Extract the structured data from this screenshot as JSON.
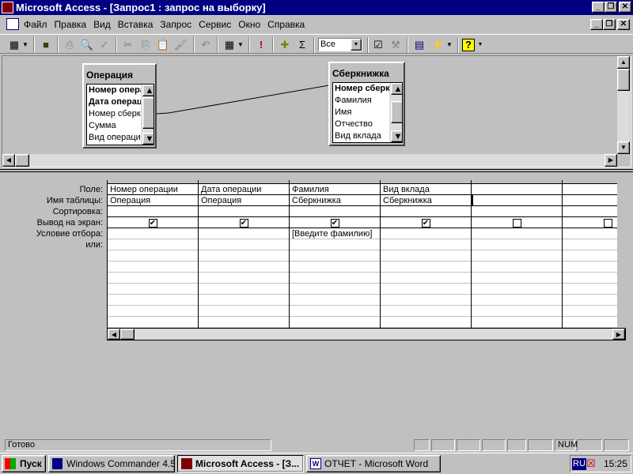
{
  "window": {
    "title": "Microsoft Access - [Запрос1 : запрос на выборку]"
  },
  "menu": [
    "Файл",
    "Правка",
    "Вид",
    "Вставка",
    "Запрос",
    "Сервис",
    "Окно",
    "Справка"
  ],
  "toolbar": {
    "top_values": "Все"
  },
  "tables": [
    {
      "name": "Операция",
      "fields": [
        "Номер операции",
        "Дата операции",
        "Номер сберкнижки",
        "Сумма",
        "Вид операции"
      ],
      "key_fields": 2
    },
    {
      "name": "Сберкнижка",
      "fields": [
        "Номер сберкнижки",
        "Фамилия",
        "Имя",
        "Отчество",
        "Вид вклада"
      ],
      "key_fields": 1
    }
  ],
  "grid": {
    "row_labels": [
      "Поле:",
      "Имя таблицы:",
      "Сортировка:",
      "Вывод на экран:",
      "Условие отбора:",
      "или:"
    ],
    "columns": [
      {
        "field": "Номер операции",
        "table": "Операция",
        "sort": "",
        "show": true,
        "criteria": ""
      },
      {
        "field": "Дата операции",
        "table": "Операция",
        "sort": "",
        "show": true,
        "criteria": ""
      },
      {
        "field": "Фамилия",
        "table": "Сберкнижка",
        "sort": "",
        "show": true,
        "criteria": "[Введите фамилию]"
      },
      {
        "field": "Вид вклада",
        "table": "Сберкнижка",
        "sort": "",
        "show": true,
        "criteria": ""
      },
      {
        "field": "",
        "table": "",
        "sort": "",
        "show": false,
        "criteria": ""
      },
      {
        "field": "",
        "table": "",
        "sort": "",
        "show": false,
        "criteria": ""
      }
    ]
  },
  "status": {
    "text": "Готово",
    "num": "NUM"
  },
  "taskbar": {
    "start": "Пуск",
    "tasks": [
      "Windows Commander 4.51...",
      "Microsoft Access - [З...",
      "ОТЧЕТ - Microsoft Word"
    ],
    "lang": "RU",
    "clock": "15:25"
  },
  "colors": {
    "titlebar": "#000080",
    "face": "#c0c0c0"
  }
}
